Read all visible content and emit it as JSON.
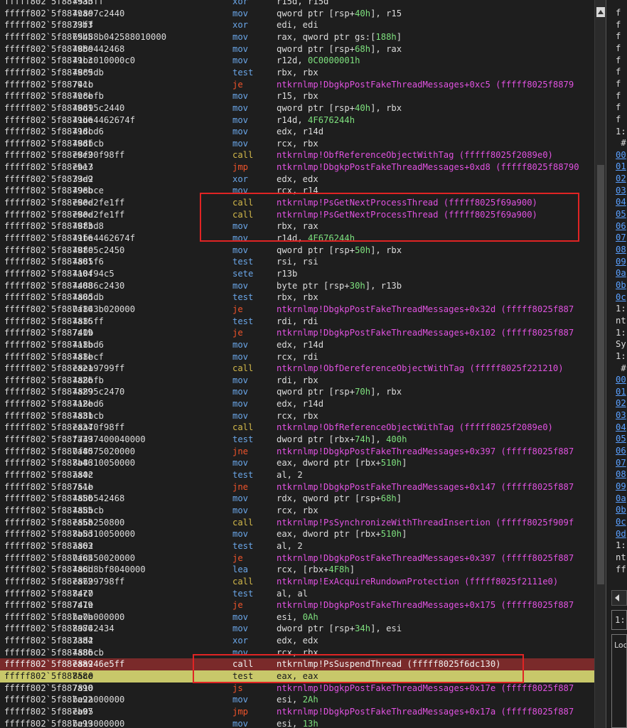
{
  "disassembly": [
    {
      "addr": "fffff802`5f8879ab",
      "bytes": "4533ff",
      "mn": "xor",
      "op": [
        {
          "t": "r15d, r15d",
          "c": "plain"
        }
      ]
    },
    {
      "addr": "fffff802`5f8879ae",
      "bytes": "4c897c2440",
      "mn": "mov",
      "op": [
        {
          "t": "qword ptr [rsp+",
          "c": "plain"
        },
        {
          "t": "40h",
          "c": "imm"
        },
        {
          "t": "], r15",
          "c": "plain"
        }
      ]
    },
    {
      "addr": "fffff802`5f8879b3",
      "bytes": "33ff",
      "mn": "xor",
      "op": [
        {
          "t": "edi, edi",
          "c": "plain"
        }
      ]
    },
    {
      "addr": "fffff802`5f8879b5",
      "bytes": "65488b042588010000",
      "mn": "mov",
      "op": [
        {
          "t": "rax, qword ptr gs:[",
          "c": "plain"
        },
        {
          "t": "188h",
          "c": "imm"
        },
        {
          "t": "]",
          "c": "plain"
        }
      ]
    },
    {
      "addr": "fffff802`5f8879be",
      "bytes": "4889442468",
      "mn": "mov",
      "op": [
        {
          "t": "qword ptr [rsp+",
          "c": "plain"
        },
        {
          "t": "68h",
          "c": "imm"
        },
        {
          "t": "], rax",
          "c": "plain"
        }
      ]
    },
    {
      "addr": "fffff802`5f8879c3",
      "bytes": "41bc010000c0",
      "mn": "mov",
      "op": [
        {
          "t": "r12d, ",
          "c": "plain"
        },
        {
          "t": "0C0000001h",
          "c": "imm"
        }
      ]
    },
    {
      "addr": "fffff802`5f8879c9",
      "bytes": "4885db",
      "mn": "test",
      "op": [
        {
          "t": "rbx, rbx",
          "c": "plain"
        }
      ]
    },
    {
      "addr": "fffff802`5f8879cc",
      "bytes": "741b",
      "mn": "je",
      "op": [
        {
          "t": "ntkrnlmp!DbgkpPostFakeThreadMessages+0xc5 (fffff8025f8879",
          "c": "sym"
        }
      ]
    },
    {
      "addr": "fffff802`5f8879ce",
      "bytes": "4c8bfb",
      "mn": "mov",
      "op": [
        {
          "t": "r15, rbx",
          "c": "plain"
        }
      ]
    },
    {
      "addr": "fffff802`5f8879d1",
      "bytes": "48895c2440",
      "mn": "mov",
      "op": [
        {
          "t": "qword ptr [rsp+",
          "c": "plain"
        },
        {
          "t": "40h",
          "c": "imm"
        },
        {
          "t": "], rbx",
          "c": "plain"
        }
      ]
    },
    {
      "addr": "fffff802`5f8879d6",
      "bytes": "41be4462674f",
      "mn": "mov",
      "op": [
        {
          "t": "r14d, ",
          "c": "plain"
        },
        {
          "t": "4F676244h",
          "c": "imm"
        }
      ]
    },
    {
      "addr": "fffff802`5f8879dc",
      "bytes": "418bd6",
      "mn": "mov",
      "op": [
        {
          "t": "edx, r14d",
          "c": "plain"
        }
      ]
    },
    {
      "addr": "fffff802`5f8879df",
      "bytes": "488bcb",
      "mn": "mov",
      "op": [
        {
          "t": "rcx, rbx",
          "c": "plain"
        }
      ]
    },
    {
      "addr": "fffff802`5f8879e2",
      "bytes": "e8f90f98ff",
      "mn": "call",
      "op": [
        {
          "t": "ntkrnlmp!ObfReferenceObjectWithTag (fffff8025f2089e0)",
          "c": "sym"
        }
      ]
    },
    {
      "addr": "fffff802`5f8879e7",
      "bytes": "eb13",
      "mn": "jmp",
      "op": [
        {
          "t": "ntkrnlmp!DbgkpPostFakeThreadMessages+0xd8 (fffff8025f88790",
          "c": "sym"
        }
      ]
    },
    {
      "addr": "fffff802`5f8879e9",
      "bytes": "33d2",
      "mn": "xor",
      "op": [
        {
          "t": "edx, edx",
          "c": "plain"
        }
      ]
    },
    {
      "addr": "fffff802`5f8879eb",
      "bytes": "498bce",
      "mn": "mov",
      "op": [
        {
          "t": "rcx, r14",
          "c": "plain"
        }
      ]
    },
    {
      "addr": "fffff802`5f8879ee",
      "bytes": "e80d2fe1ff",
      "mn": "call",
      "op": [
        {
          "t": "ntkrnlmp!PsGetNextProcessThread (fffff8025f69a900)",
          "c": "sym"
        }
      ]
    },
    {
      "addr": "fffff802`5f8879ee",
      "bytes": "e80d2fe1ff",
      "mn": "call",
      "op": [
        {
          "t": "ntkrnlmp!PsGetNextProcessThread (fffff8025f69a900)",
          "c": "sym"
        }
      ]
    },
    {
      "addr": "fffff802`5f8879f3",
      "bytes": "488bd8",
      "mn": "mov",
      "op": [
        {
          "t": "rbx, rax",
          "c": "plain"
        }
      ]
    },
    {
      "addr": "fffff802`5f8879f6",
      "bytes": "41be4462674f",
      "mn": "mov",
      "op": [
        {
          "t": "r14d, ",
          "c": "plain"
        },
        {
          "t": "4F676244h",
          "c": "imm"
        }
      ]
    },
    {
      "addr": "fffff802`5f8879fc",
      "bytes": "48895c2450",
      "mn": "mov",
      "op": [
        {
          "t": "qword ptr [rsp+",
          "c": "plain"
        },
        {
          "t": "50h",
          "c": "imm"
        },
        {
          "t": "], rbx",
          "c": "plain"
        }
      ]
    },
    {
      "addr": "fffff802`5f887a01",
      "bytes": "4885f6",
      "mn": "test",
      "op": [
        {
          "t": "rsi, rsi",
          "c": "plain"
        }
      ]
    },
    {
      "addr": "fffff802`5f887a04",
      "bytes": "410f94c5",
      "mn": "sete",
      "op": [
        {
          "t": "r13b",
          "c": "plain"
        }
      ]
    },
    {
      "addr": "fffff802`5f887a08",
      "bytes": "44886c2430",
      "mn": "mov",
      "op": [
        {
          "t": "byte ptr [rsp+",
          "c": "plain"
        },
        {
          "t": "30h",
          "c": "imm"
        },
        {
          "t": "], r13b",
          "c": "plain"
        }
      ]
    },
    {
      "addr": "fffff802`5f887a0d",
      "bytes": "4885db",
      "mn": "test",
      "op": [
        {
          "t": "rbx, rbx",
          "c": "plain"
        }
      ]
    },
    {
      "addr": "fffff802`5f887a10",
      "bytes": "0f843b020000",
      "mn": "je",
      "op": [
        {
          "t": "ntkrnlmp!DbgkpPostFakeThreadMessages+0x32d (fffff8025f887",
          "c": "sym"
        }
      ]
    },
    {
      "addr": "fffff802`5f887a16",
      "bytes": "4885ff",
      "mn": "test",
      "op": [
        {
          "t": "rdi, rdi",
          "c": "plain"
        }
      ]
    },
    {
      "addr": "fffff802`5f887a19",
      "bytes": "740b",
      "mn": "je",
      "op": [
        {
          "t": "ntkrnlmp!DbgkpPostFakeThreadMessages+0x102 (fffff8025f887",
          "c": "sym"
        }
      ]
    },
    {
      "addr": "fffff802`5f887a1b",
      "bytes": "418bd6",
      "mn": "mov",
      "op": [
        {
          "t": "edx, r14d",
          "c": "plain"
        }
      ]
    },
    {
      "addr": "fffff802`5f887a1e",
      "bytes": "488bcf",
      "mn": "mov",
      "op": [
        {
          "t": "rcx, rdi",
          "c": "plain"
        }
      ]
    },
    {
      "addr": "fffff802`5f887a21",
      "bytes": "e8ea9799ff",
      "mn": "call",
      "op": [
        {
          "t": "ntkrnlmp!ObfDereferenceObjectWithTag (fffff8025f221210)",
          "c": "sym"
        }
      ]
    },
    {
      "addr": "fffff802`5f887a26",
      "bytes": "488bfb",
      "mn": "mov",
      "op": [
        {
          "t": "rdi, rbx",
          "c": "plain"
        }
      ]
    },
    {
      "addr": "fffff802`5f887a29",
      "bytes": "48895c2470",
      "mn": "mov",
      "op": [
        {
          "t": "qword ptr [rsp+",
          "c": "plain"
        },
        {
          "t": "70h",
          "c": "imm"
        },
        {
          "t": "], rbx",
          "c": "plain"
        }
      ]
    },
    {
      "addr": "fffff802`5f887a2e",
      "bytes": "418bd6",
      "mn": "mov",
      "op": [
        {
          "t": "edx, r14d",
          "c": "plain"
        }
      ]
    },
    {
      "addr": "fffff802`5f887a31",
      "bytes": "488bcb",
      "mn": "mov",
      "op": [
        {
          "t": "rcx, rbx",
          "c": "plain"
        }
      ]
    },
    {
      "addr": "fffff802`5f887a34",
      "bytes": "e8a70f98ff",
      "mn": "call",
      "op": [
        {
          "t": "ntkrnlmp!ObfReferenceObjectWithTag (fffff8025f2089e0)",
          "c": "sym"
        }
      ]
    },
    {
      "addr": "fffff802`5f887a39",
      "bytes": "f7437400040000",
      "mn": "test",
      "op": [
        {
          "t": "dword ptr [rbx+",
          "c": "plain"
        },
        {
          "t": "74h",
          "c": "imm"
        },
        {
          "t": "], ",
          "c": "plain"
        },
        {
          "t": "400h",
          "c": "imm"
        }
      ]
    },
    {
      "addr": "fffff802`5f887a40",
      "bytes": "0f8575020000",
      "mn": "jne",
      "op": [
        {
          "t": "ntkrnlmp!DbgkpPostFakeThreadMessages+0x397 (fffff8025f887",
          "c": "sym"
        }
      ]
    },
    {
      "addr": "fffff802`5f887a46",
      "bytes": "8b8310050000",
      "mn": "mov",
      "op": [
        {
          "t": "eax, dword ptr [rbx+",
          "c": "plain"
        },
        {
          "t": "510h",
          "c": "imm"
        },
        {
          "t": "]",
          "c": "plain"
        }
      ]
    },
    {
      "addr": "fffff802`5f887a4c",
      "bytes": "a802",
      "mn": "test",
      "op": [
        {
          "t": "al, 2",
          "c": "plain"
        }
      ]
    },
    {
      "addr": "fffff802`5f887a4e",
      "bytes": "751b",
      "mn": "jne",
      "op": [
        {
          "t": "ntkrnlmp!DbgkpPostFakeThreadMessages+0x147 (fffff8025f887",
          "c": "sym"
        }
      ]
    },
    {
      "addr": "fffff802`5f887a50",
      "bytes": "488b542468",
      "mn": "mov",
      "op": [
        {
          "t": "rdx, qword ptr [rsp+",
          "c": "plain"
        },
        {
          "t": "68h",
          "c": "imm"
        },
        {
          "t": "]",
          "c": "plain"
        }
      ]
    },
    {
      "addr": "fffff802`5f887a55",
      "bytes": "488bcb",
      "mn": "mov",
      "op": [
        {
          "t": "rcx, rbx",
          "c": "plain"
        }
      ]
    },
    {
      "addr": "fffff802`5f887a58",
      "bytes": "e86b250800",
      "mn": "call",
      "op": [
        {
          "t": "ntkrnlmp!PsSynchronizeWithThreadInsertion (fffff8025f909f",
          "c": "sym"
        }
      ]
    },
    {
      "addr": "fffff802`5f887a5d",
      "bytes": "8b8310050000",
      "mn": "mov",
      "op": [
        {
          "t": "eax, dword ptr [rbx+",
          "c": "plain"
        },
        {
          "t": "510h",
          "c": "imm"
        },
        {
          "t": "]",
          "c": "plain"
        }
      ]
    },
    {
      "addr": "fffff802`5f887a63",
      "bytes": "a802",
      "mn": "test",
      "op": [
        {
          "t": "al, 2",
          "c": "plain"
        }
      ]
    },
    {
      "addr": "fffff802`5f887a65",
      "bytes": "0f8450020000",
      "mn": "je",
      "op": [
        {
          "t": "ntkrnlmp!DbgkpPostFakeThreadMessages+0x397 (fffff8025f887",
          "c": "sym"
        }
      ]
    },
    {
      "addr": "fffff802`5f887a6b",
      "bytes": "488d8bf8040000",
      "mn": "lea",
      "op": [
        {
          "t": "rcx, [rbx+",
          "c": "plain"
        },
        {
          "t": "4F8h",
          "c": "imm"
        },
        {
          "t": "]",
          "c": "plain"
        }
      ]
    },
    {
      "addr": "fffff802`5f887a72",
      "bytes": "e8699798ff",
      "mn": "call",
      "op": [
        {
          "t": "ntkrnlmp!ExAcquireRundownProtection (fffff8025f2111e0)",
          "c": "sym"
        }
      ]
    },
    {
      "addr": "fffff802`5f887a77",
      "bytes": "84c0",
      "mn": "test",
      "op": [
        {
          "t": "al, al",
          "c": "plain"
        }
      ]
    },
    {
      "addr": "fffff802`5f887a79",
      "bytes": "741e",
      "mn": "je",
      "op": [
        {
          "t": "ntkrnlmp!DbgkpPostFakeThreadMessages+0x175 (fffff8025f887",
          "c": "sym"
        }
      ]
    },
    {
      "addr": "fffff802`5f887a7b",
      "bytes": "be0a000000",
      "mn": "mov",
      "op": [
        {
          "t": "esi, ",
          "c": "plain"
        },
        {
          "t": "0Ah",
          "c": "imm"
        }
      ]
    },
    {
      "addr": "fffff802`5f887a80",
      "bytes": "89742434",
      "mn": "mov",
      "op": [
        {
          "t": "dword ptr [rsp+",
          "c": "plain"
        },
        {
          "t": "34h",
          "c": "imm"
        },
        {
          "t": "], esi",
          "c": "plain"
        }
      ]
    },
    {
      "addr": "fffff802`5f887a84",
      "bytes": "33d2",
      "mn": "xor",
      "op": [
        {
          "t": "edx, edx",
          "c": "plain"
        }
      ]
    },
    {
      "addr": "fffff802`5f887a86",
      "bytes": "488bcb",
      "mn": "mov",
      "op": [
        {
          "t": "rcx, rbx",
          "c": "plain"
        }
      ]
    },
    {
      "addr": "fffff802`5f887a89",
      "bytes": "e8a246e5ff",
      "mn": "call",
      "op": [
        {
          "t": "ntkrnlmp!PsSuspendThread (fffff8025f6dc130)",
          "c": "sym"
        }
      ],
      "state": "breakpoint"
    },
    {
      "addr": "fffff802`5f887a8e",
      "bytes": "85c0",
      "mn": "test",
      "op": [
        {
          "t": "eax, eax",
          "c": "plain"
        }
      ],
      "state": "current"
    },
    {
      "addr": "fffff802`5f887a90",
      "bytes": "7810",
      "mn": "js",
      "op": [
        {
          "t": "ntkrnlmp!DbgkpPostFakeThreadMessages+0x17e (fffff8025f887",
          "c": "sym"
        }
      ]
    },
    {
      "addr": "fffff802`5f887a92",
      "bytes": "be2a000000",
      "mn": "mov",
      "op": [
        {
          "t": "esi, ",
          "c": "plain"
        },
        {
          "t": "2Ah",
          "c": "imm"
        }
      ]
    },
    {
      "addr": "fffff802`5f887a97",
      "bytes": "eb05",
      "mn": "jmp",
      "op": [
        {
          "t": "ntkrnlmp!DbgkpPostFakeThreadMessages+0x17a (fffff8025f887",
          "c": "sym"
        }
      ]
    },
    {
      "addr": "fffff802`5f887a99",
      "bytes": "be13000000",
      "mn": "mov",
      "op": [
        {
          "t": "esi, ",
          "c": "plain"
        },
        {
          "t": "13h",
          "c": "imm"
        }
      ]
    }
  ],
  "right_panel": {
    "lines": [
      {
        "t": "f",
        "c": "plain"
      },
      {
        "t": "f",
        "c": "plain"
      },
      {
        "t": "f",
        "c": "plain"
      },
      {
        "t": "f",
        "c": "plain"
      },
      {
        "t": "f",
        "c": "plain"
      },
      {
        "t": "f",
        "c": "plain"
      },
      {
        "t": "f",
        "c": "plain"
      },
      {
        "t": "f",
        "c": "plain"
      },
      {
        "t": "f",
        "c": "plain"
      },
      {
        "t": "f",
        "c": "plain"
      },
      {
        "t": "1:",
        "c": "plain"
      },
      {
        "t": " #",
        "c": "plain"
      },
      {
        "t": "00",
        "c": "link"
      },
      {
        "t": "01",
        "c": "link"
      },
      {
        "t": "02",
        "c": "link"
      },
      {
        "t": "03",
        "c": "link"
      },
      {
        "t": "04",
        "c": "link"
      },
      {
        "t": "05",
        "c": "link"
      },
      {
        "t": "06",
        "c": "link"
      },
      {
        "t": "07",
        "c": "link"
      },
      {
        "t": "08",
        "c": "link"
      },
      {
        "t": "09",
        "c": "link"
      },
      {
        "t": "0a",
        "c": "link"
      },
      {
        "t": "0b",
        "c": "link"
      },
      {
        "t": "0c",
        "c": "link"
      },
      {
        "t": "1:",
        "c": "plain"
      },
      {
        "t": "nt",
        "c": "plain"
      },
      {
        "t": "1:",
        "c": "plain"
      },
      {
        "t": "Sy",
        "c": "plain"
      },
      {
        "t": "1:",
        "c": "plain"
      },
      {
        "t": " #",
        "c": "plain"
      },
      {
        "t": "00",
        "c": "link"
      },
      {
        "t": "01",
        "c": "link"
      },
      {
        "t": "02",
        "c": "link"
      },
      {
        "t": "03",
        "c": "link"
      },
      {
        "t": "04",
        "c": "link"
      },
      {
        "t": "05",
        "c": "link"
      },
      {
        "t": "06",
        "c": "link"
      },
      {
        "t": "07",
        "c": "link"
      },
      {
        "t": "08",
        "c": "link"
      },
      {
        "t": "09",
        "c": "link"
      },
      {
        "t": "0a",
        "c": "link"
      },
      {
        "t": "0b",
        "c": "link"
      },
      {
        "t": "0c",
        "c": "link"
      },
      {
        "t": "0d",
        "c": "link"
      },
      {
        "t": "1:",
        "c": "plain"
      },
      {
        "t": "nt",
        "c": "plain"
      },
      {
        "t": "ff",
        "c": "plain"
      }
    ],
    "cmd_prompt": "1:",
    "locals_label": "Loc"
  },
  "colors": {
    "background": "#1e1e1e",
    "mnemonic": "#6aa6e8",
    "call": "#d2b84a",
    "jump": "#f0542b",
    "symbol": "#e052e0",
    "immediate": "#7ee07e",
    "breakpoint_row": "#7a2a2a",
    "current_row": "#c8c86a",
    "annotation_box": "#e02424"
  }
}
